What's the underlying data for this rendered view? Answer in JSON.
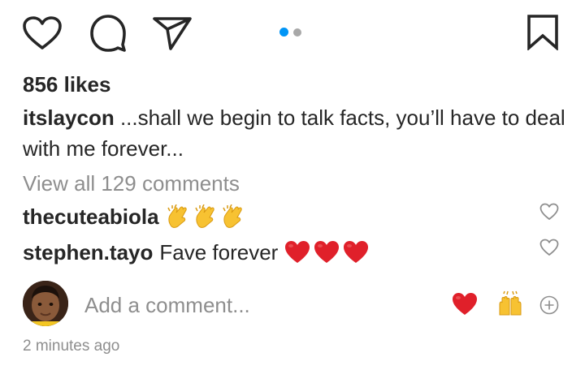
{
  "actions": {
    "like_icon": "heart-outline-icon",
    "comment_icon": "comment-bubble-icon",
    "share_icon": "paper-plane-icon",
    "save_icon": "bookmark-icon",
    "carousel_position": "1 of 2"
  },
  "post": {
    "likes": "856 likes",
    "caption_user": "itslaycon",
    "caption_text": " ...shall we begin to talk facts, you’ll have to deal with me forever...",
    "view_all": "View all 129 comments"
  },
  "comments": [
    {
      "user": "thecuteabiola",
      "text": "",
      "emoji": "clapping-hands x3"
    },
    {
      "user": "stephen.tayo",
      "text": "Fave forever",
      "emoji": "red-heart x3"
    }
  ],
  "composer": {
    "placeholder": "Add a comment...",
    "quick_reactions": [
      "red-heart",
      "raising-hands"
    ],
    "add_icon": "plus-circle-icon"
  },
  "timestamp": "2 minutes ago",
  "colors": {
    "accent": "#0095f6",
    "text": "#262626",
    "muted": "#8e8e8e",
    "heart": "#e0202a"
  }
}
